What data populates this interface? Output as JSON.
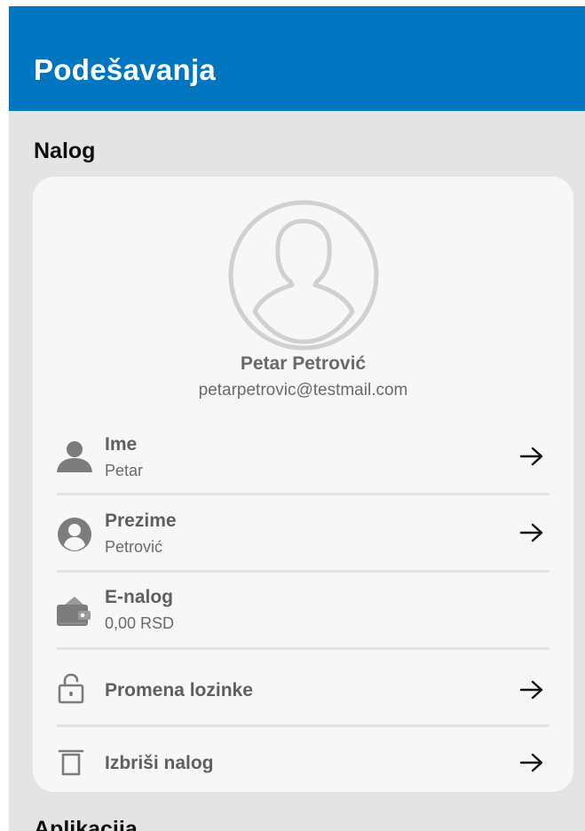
{
  "app_bar": {
    "title": "Podešavanja"
  },
  "sections": {
    "account": "Nalog",
    "app": "Aplikacija"
  },
  "profile": {
    "name": "Petar Petrović",
    "email": "petarpetrovic@testmail.com",
    "avatar_icon": "user-circle-icon"
  },
  "rows": {
    "first_name": {
      "label": "Ime",
      "value": "Petar",
      "icon": "person-icon"
    },
    "last_name": {
      "label": "Prezime",
      "value": "Petrović",
      "icon": "account-circle-icon"
    },
    "e_account": {
      "label": "E-nalog",
      "value": "0,00 RSD",
      "icon": "wallet-icon"
    },
    "change_password": {
      "label": "Promena lozinke",
      "icon": "lock-icon"
    },
    "delete_account": {
      "label": "Izbriši nalog",
      "icon": "trash-icon"
    }
  },
  "colors": {
    "app_bar": "#0076c0",
    "background": "#e4e4e4",
    "card": "#f7f7f7",
    "icon_gray": "#7c7c7c",
    "avatar_gray": "#d0d0d0"
  }
}
